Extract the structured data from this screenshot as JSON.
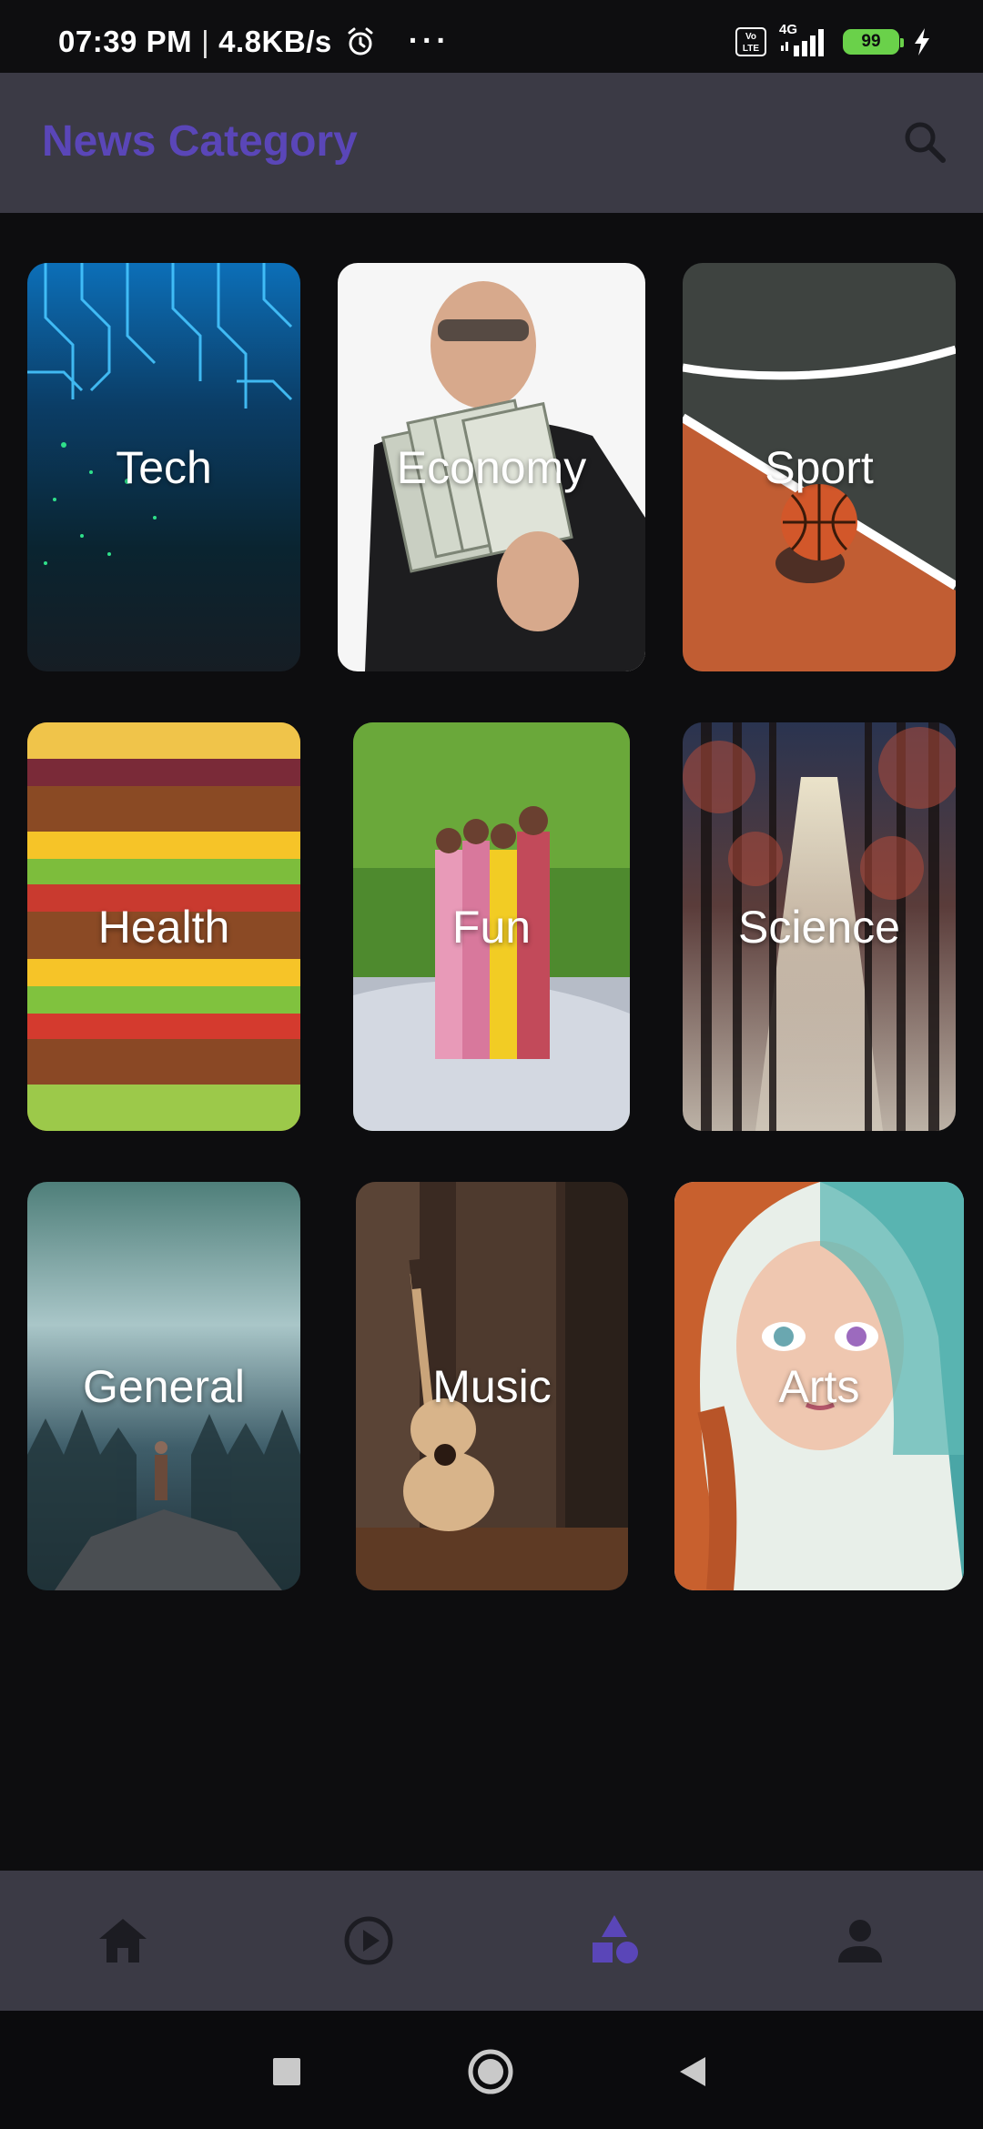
{
  "status_bar": {
    "time": "07:39 PM",
    "separator": "|",
    "speed": "4.8KB/s",
    "dots": "···",
    "volte": "Vo LTE",
    "network": "4G",
    "battery": "99"
  },
  "app_bar": {
    "title": "News Category"
  },
  "categories": [
    {
      "label": "Tech",
      "icon": "tech-image"
    },
    {
      "label": "Economy",
      "icon": "economy-image"
    },
    {
      "label": "Sport",
      "icon": "sport-image"
    },
    {
      "label": "Health",
      "icon": "health-image"
    },
    {
      "label": "Fun",
      "icon": "fun-image"
    },
    {
      "label": "Science",
      "icon": "science-image"
    },
    {
      "label": "General",
      "icon": "general-image"
    },
    {
      "label": "Music",
      "icon": "music-image"
    },
    {
      "label": "Arts",
      "icon": "arts-image"
    }
  ],
  "bottom_nav": {
    "items": [
      {
        "icon": "home-icon",
        "active": false
      },
      {
        "icon": "play-icon",
        "active": false
      },
      {
        "icon": "category-icon",
        "active": true
      },
      {
        "icon": "profile-icon",
        "active": false
      }
    ]
  },
  "colors": {
    "accent": "#5a46b8",
    "app_bar": "#3b3a45",
    "background": "#0d0d0f",
    "inactive_icon": "#1c1c22"
  }
}
